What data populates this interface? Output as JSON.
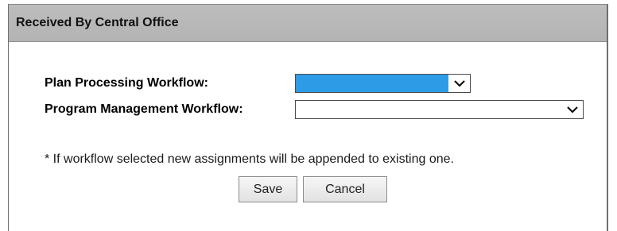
{
  "dialog": {
    "title": "Received By Central Office"
  },
  "form": {
    "plan_processing": {
      "label": "Plan Processing Workflow:",
      "selected_value": ""
    },
    "program_management": {
      "label": "Program Management Workflow:",
      "selected_value": ""
    },
    "note": "* If workflow selected new assignments will be appended to existing one."
  },
  "buttons": {
    "save": "Save",
    "cancel": "Cancel"
  },
  "colors": {
    "titlebar": "#b8b8b8",
    "selection_highlight": "#2e9be6"
  },
  "icons": {
    "dropdown": "chevron-down-icon"
  }
}
